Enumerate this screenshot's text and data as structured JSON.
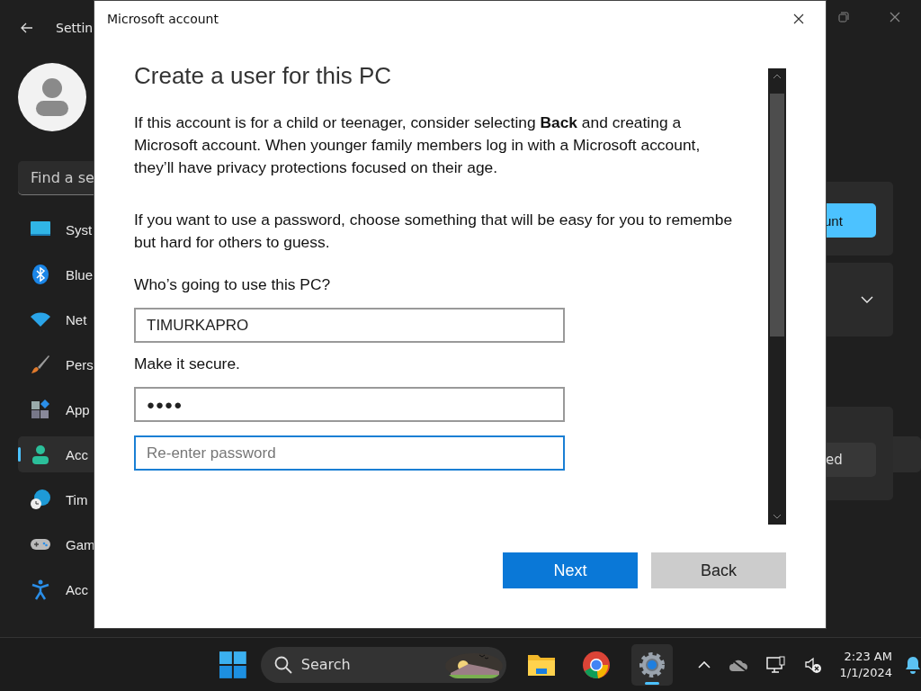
{
  "settings_window": {
    "title": "Settin",
    "search": {
      "placeholder": "Find a se"
    },
    "sidebar": {
      "items": [
        {
          "label": "Syst",
          "selected": false
        },
        {
          "label": "Blue",
          "selected": false
        },
        {
          "label": "Net",
          "selected": false
        },
        {
          "label": "Pers",
          "selected": false
        },
        {
          "label": "App",
          "selected": false
        },
        {
          "label": "Acc",
          "selected": true
        },
        {
          "label": "Tim",
          "selected": false
        },
        {
          "label": "Gam",
          "selected": false
        },
        {
          "label": "Acc",
          "selected": false
        }
      ]
    },
    "right_panel": {
      "primary_button": "unt",
      "secondary_button": "ed"
    }
  },
  "dialog": {
    "title": "Microsoft account",
    "heading": "Create a user for this PC",
    "paragraphs": [
      [
        "If this account is for a child or teenager, consider selecting **Back** and creating a",
        "Microsoft account. When younger family members log in with a Microsoft account,",
        "they’ll have privacy protections focused on their age."
      ],
      [
        "If you want to use a password, choose something that will be easy for you to remembe",
        "but hard for others to guess."
      ]
    ],
    "fields": [
      {
        "kind": "label",
        "text": "Who’s going to use this PC?"
      },
      {
        "kind": "input",
        "value": "TIMURKAPRO",
        "focused": false
      },
      {
        "kind": "label",
        "text": "Make it secure."
      },
      {
        "kind": "password",
        "value": "●●●●",
        "focused": false
      },
      {
        "kind": "input",
        "placeholder": "Re-enter password",
        "focused": true
      }
    ],
    "buttons": [
      {
        "label": "Next",
        "primary": true
      },
      {
        "label": "Back",
        "primary": false
      }
    ]
  },
  "taskbar": {
    "search": "Search",
    "apps": [
      {
        "active": false
      },
      {
        "active": false
      },
      {
        "active": true
      }
    ],
    "time": "2:23 AM",
    "date": "1/1/2024"
  }
}
